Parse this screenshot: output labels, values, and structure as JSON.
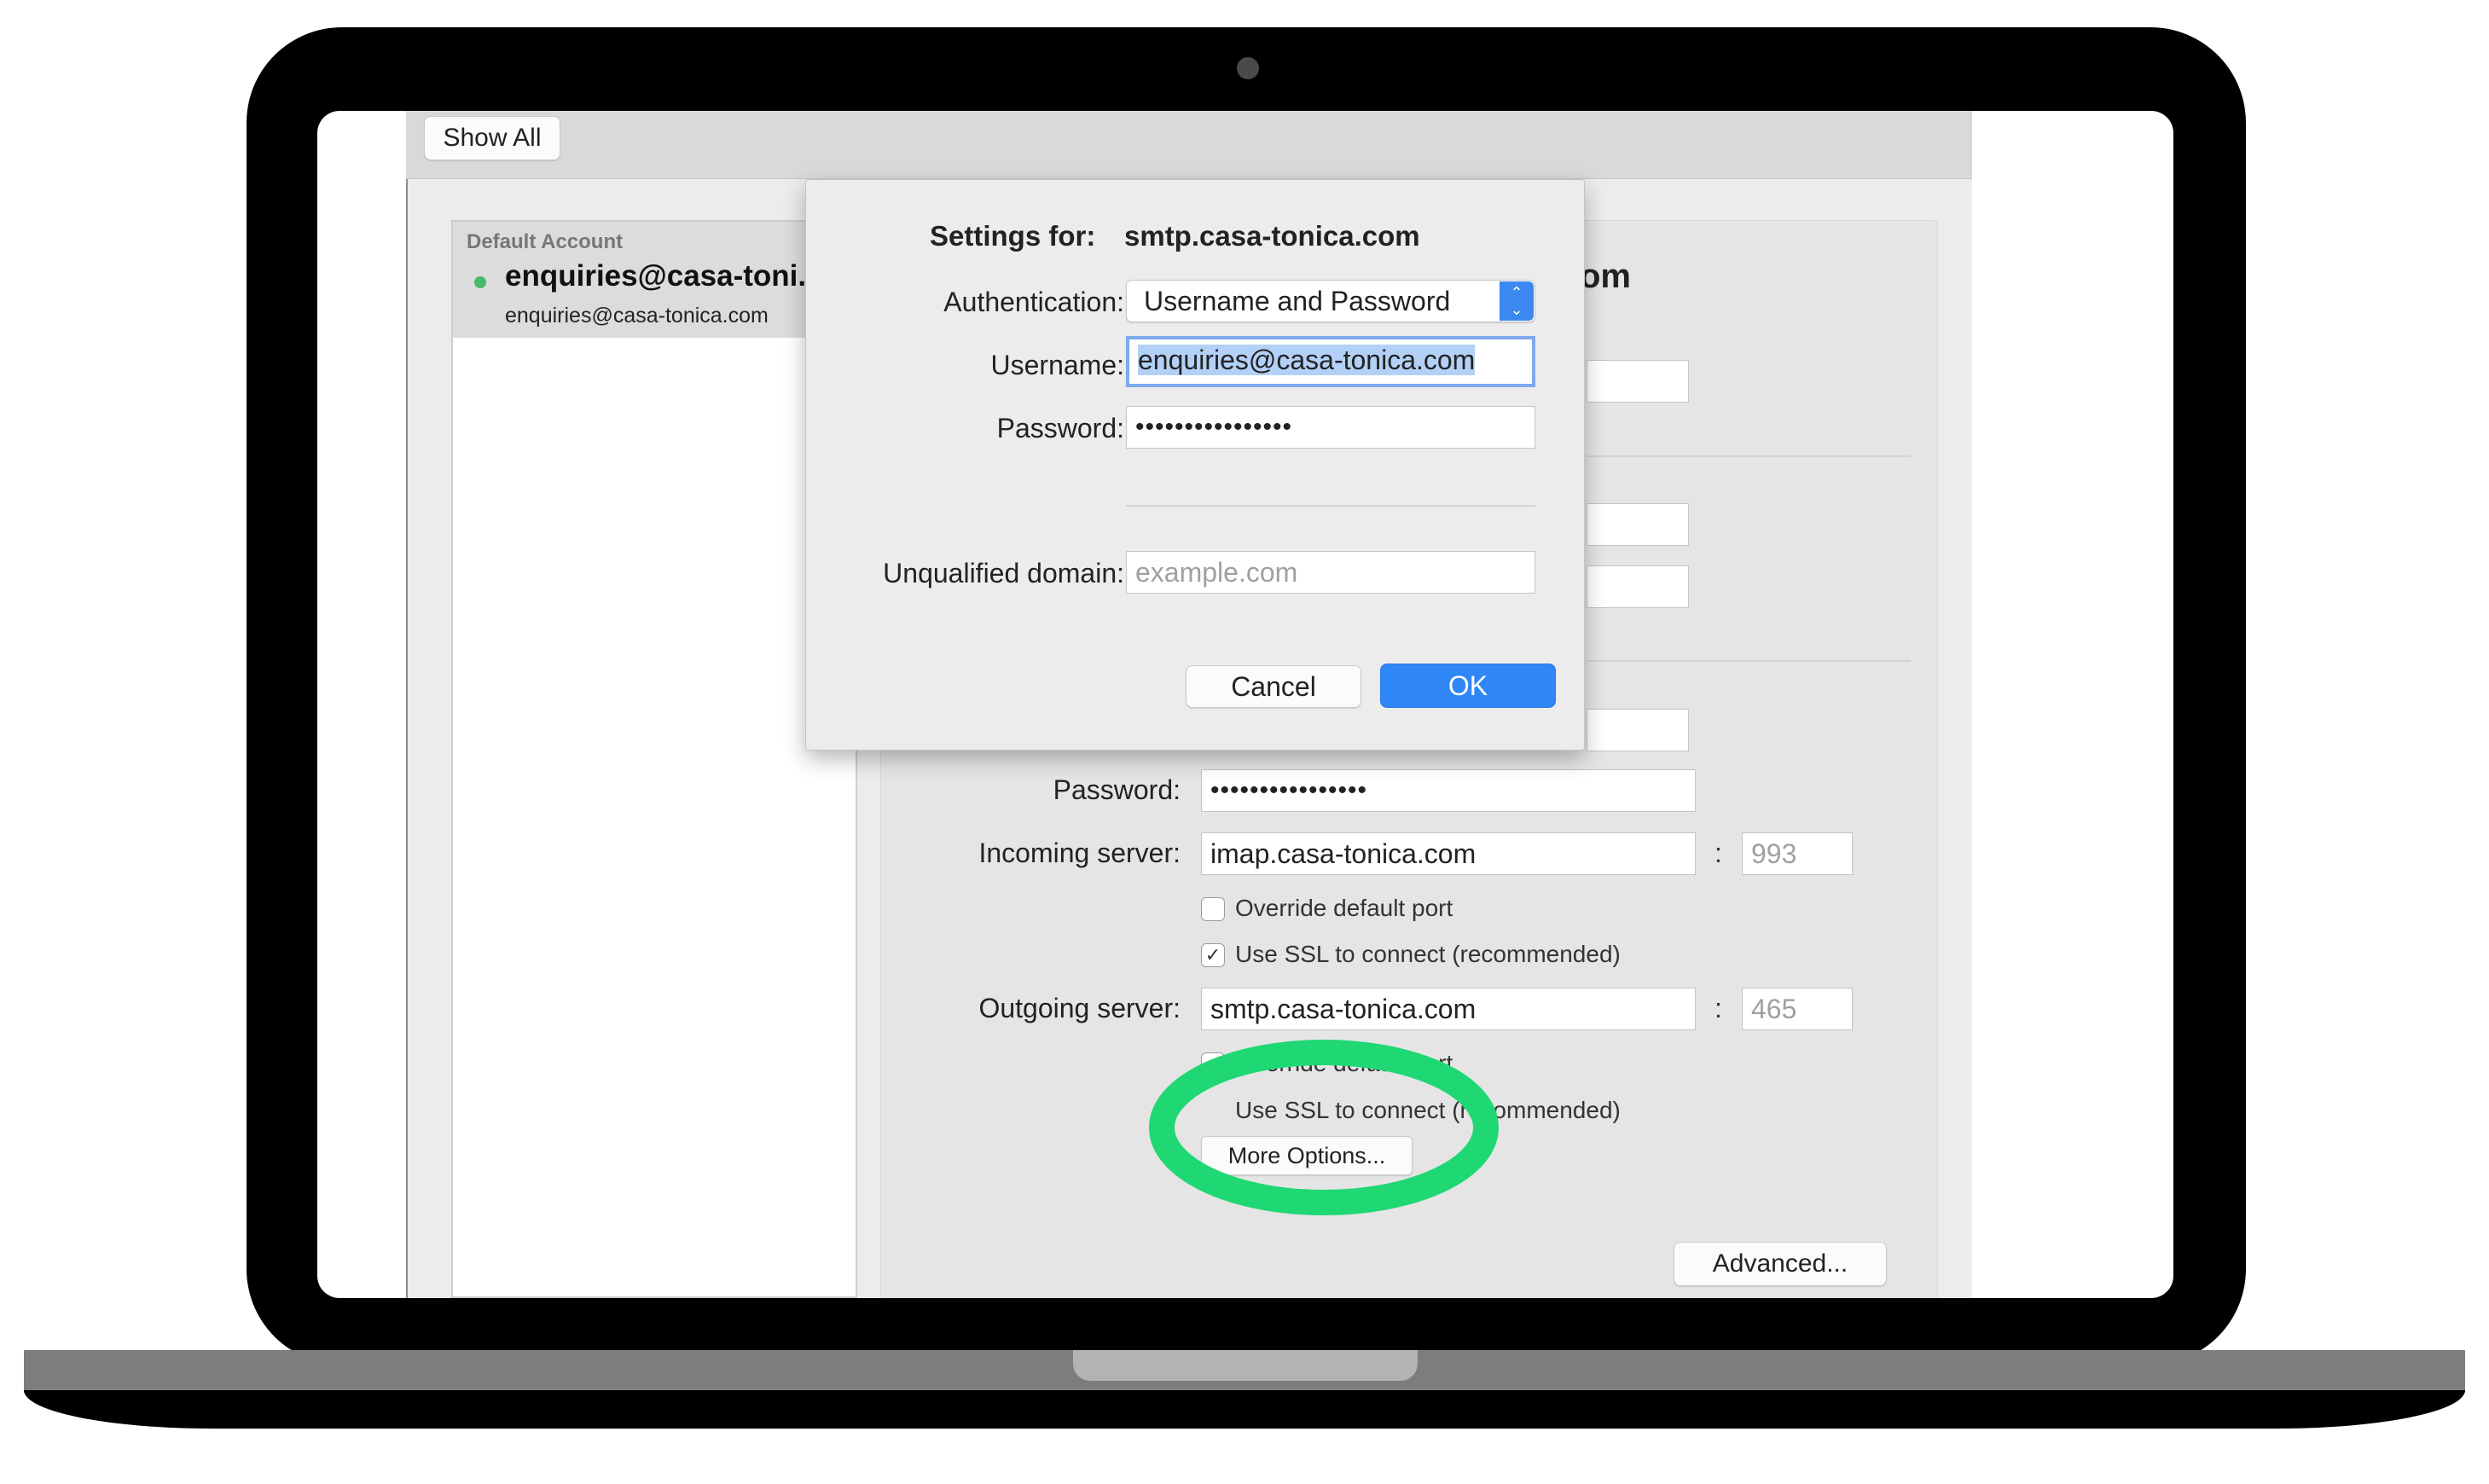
{
  "toolbar": {
    "show_all_label": "Show All"
  },
  "accounts_list": {
    "section_label": "Default Account",
    "account_name": "enquiries@casa-toni...",
    "account_email": "enquiries@casa-tonica.com"
  },
  "account_pane": {
    "heading_fragment": "om",
    "password_label": "Password:",
    "password_value": "••••••••••••••••",
    "incoming_server_label": "Incoming server:",
    "incoming_server_value": "imap.casa-tonica.com",
    "incoming_port": "993",
    "override_port_label": "Override default port",
    "use_ssl_label": "Use SSL to connect (recommended)",
    "outgoing_server_label": "Outgoing server:",
    "outgoing_server_value": "smtp.casa-tonica.com",
    "outgoing_port": "465",
    "outgoing_override_port_label": "Override default port",
    "outgoing_use_ssl_label": "Use SSL to connect (recommended)",
    "more_options_label": "More Options...",
    "advanced_label": "Advanced...",
    "separator": ":"
  },
  "checkboxes": {
    "checked_glyph": "✓"
  },
  "sheet": {
    "settings_for_label": "Settings for:",
    "settings_for_value": "smtp.casa-tonica.com",
    "authentication_label": "Authentication:",
    "authentication_value": "Username and Password",
    "username_label": "Username:",
    "username_value": "enquiries@casa-tonica.com",
    "password_label": "Password:",
    "password_value": "••••••••••••••••",
    "unqualified_domain_label": "Unqualified domain:",
    "unqualified_domain_placeholder": "example.com",
    "cancel_label": "Cancel",
    "ok_label": "OK"
  },
  "colors": {
    "accent_blue": "#2f86f6",
    "status_dot": "#49b96a",
    "highlight_circle": "#1fd873"
  },
  "icons": {
    "select_arrows": "chevron-updown-icon",
    "status_dot": "online-dot-icon"
  }
}
